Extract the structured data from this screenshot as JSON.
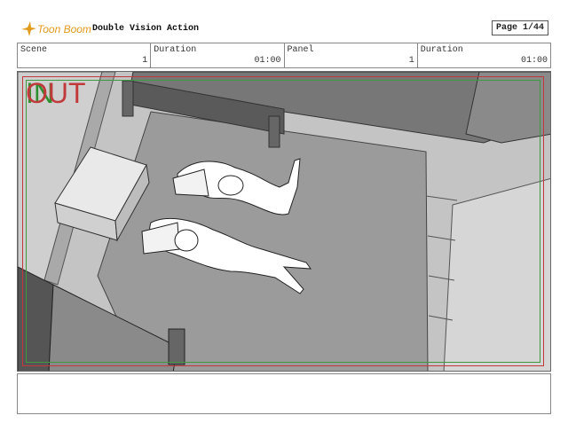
{
  "header": {
    "logo_text": "Toon Boom",
    "project_title": "Double Vision Action",
    "page_label": "Page",
    "page_value": "1/44"
  },
  "info": {
    "scene_label": "Scene",
    "scene_value": "1",
    "duration1_label": "Duration",
    "duration1_value": "01:00",
    "panel_label": "Panel",
    "panel_value": "1",
    "duration2_label": "Duration",
    "duration2_value": "01:00"
  },
  "panel": {
    "in_mark": "IN",
    "out_mark": "OUT"
  },
  "notes": {
    "text": ""
  },
  "colors": {
    "logo_orange": "#e39a1a",
    "safe_red": "#c0393b",
    "safe_green": "#3f9a3f"
  }
}
